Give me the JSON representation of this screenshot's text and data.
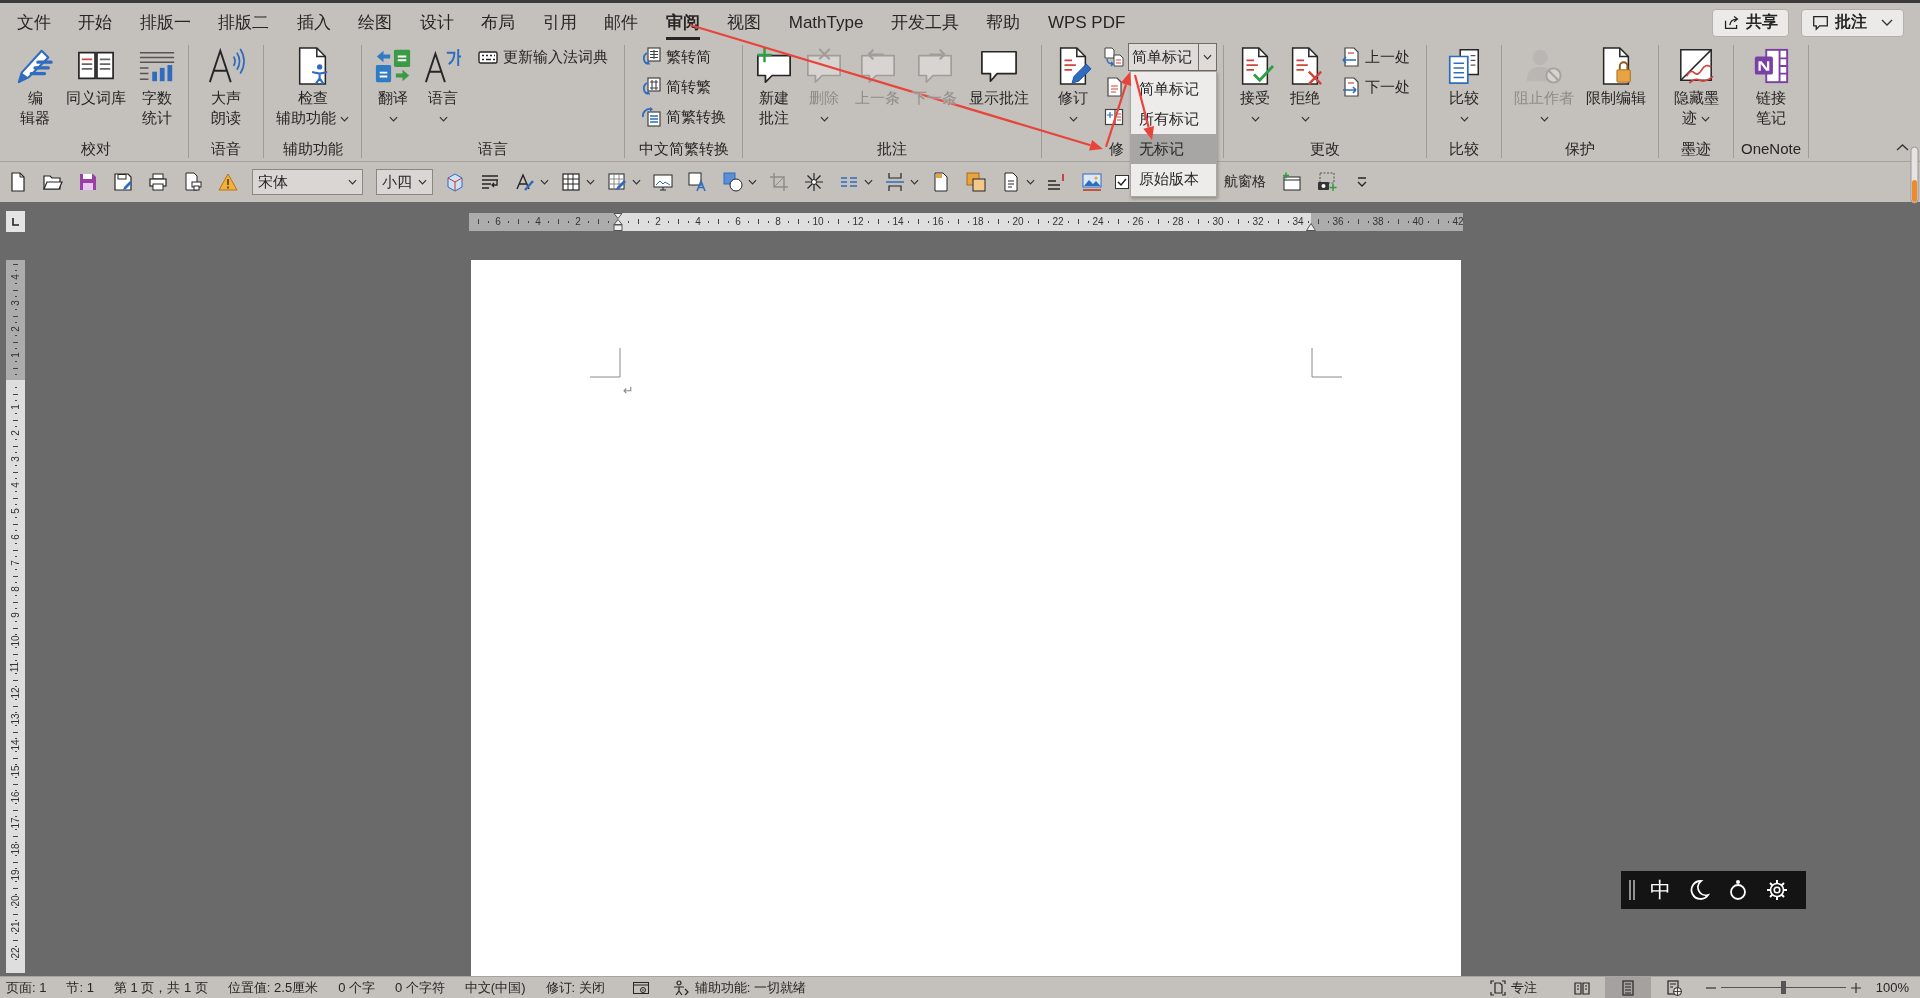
{
  "tabs": [
    {
      "label": "文件",
      "selected": false
    },
    {
      "label": "开始",
      "selected": false
    },
    {
      "label": "排版一",
      "selected": false
    },
    {
      "label": "排版二",
      "selected": false
    },
    {
      "label": "插入",
      "selected": false
    },
    {
      "label": "绘图",
      "selected": false
    },
    {
      "label": "设计",
      "selected": false
    },
    {
      "label": "布局",
      "selected": false
    },
    {
      "label": "引用",
      "selected": false
    },
    {
      "label": "邮件",
      "selected": false
    },
    {
      "label": "审阅",
      "selected": true
    },
    {
      "label": "视图",
      "selected": false
    },
    {
      "label": "MathType",
      "selected": false
    },
    {
      "label": "开发工具",
      "selected": false
    },
    {
      "label": "帮助",
      "selected": false
    },
    {
      "label": "WPS PDF",
      "selected": false
    }
  ],
  "header_buttons": [
    {
      "label": "共享",
      "dropdown": false
    },
    {
      "label": "批注",
      "dropdown": true
    }
  ],
  "ribbon": {
    "groups": [
      {
        "label": "校对",
        "items": [
          {
            "kind": "large",
            "lines": [
              "编",
              "辑器"
            ],
            "disabled": false,
            "dropdown": false
          },
          {
            "kind": "large",
            "lines": [
              "同义词库"
            ],
            "disabled": false,
            "dropdown": false
          },
          {
            "kind": "large",
            "lines": [
              "字数",
              "统计"
            ],
            "disabled": false,
            "dropdown": false
          }
        ]
      },
      {
        "label": "语音",
        "items": [
          {
            "kind": "large",
            "lines": [
              "大声",
              "朗读"
            ],
            "disabled": false,
            "dropdown": false
          }
        ]
      },
      {
        "label": "辅助功能",
        "items": [
          {
            "kind": "large",
            "lines": [
              "检查",
              "辅助功能"
            ],
            "disabled": false,
            "dropdown": true
          }
        ]
      },
      {
        "label": "语言",
        "items": [
          {
            "kind": "large",
            "lines": [
              "翻译"
            ],
            "disabled": false,
            "dropdown": true
          },
          {
            "kind": "large",
            "lines": [
              "语言"
            ],
            "disabled": false,
            "dropdown": true
          },
          {
            "kind": "stack",
            "buttons": [
              {
                "label": "更新输入法词典"
              }
            ]
          }
        ]
      },
      {
        "label": "中文简繁转换",
        "items": [
          {
            "kind": "stack",
            "buttons": [
              {
                "label": "繁转简"
              },
              {
                "label": "简转繁"
              },
              {
                "label": "简繁转换"
              }
            ]
          }
        ]
      },
      {
        "label": "批注",
        "items": [
          {
            "kind": "large",
            "lines": [
              "新建",
              "批注"
            ],
            "disabled": false,
            "dropdown": false
          },
          {
            "kind": "large",
            "lines": [
              "删除"
            ],
            "disabled": true,
            "dropdown": true
          },
          {
            "kind": "large",
            "lines": [
              "上一条"
            ],
            "disabled": true,
            "dropdown": false
          },
          {
            "kind": "large",
            "lines": [
              "下一条"
            ],
            "disabled": true,
            "dropdown": false
          },
          {
            "kind": "large",
            "lines": [
              "显示批注"
            ],
            "disabled": false,
            "dropdown": false
          }
        ]
      },
      {
        "label": "修",
        "launcher": true,
        "items": [
          {
            "kind": "large",
            "lines": [
              "修订"
            ],
            "disabled": false,
            "dropdown": true
          },
          {
            "kind": "icon_stack"
          },
          {
            "kind": "combo",
            "value": "简单标记",
            "menu": [
              {
                "label": "简单标记",
                "highlighted": false
              },
              {
                "label": "所有标记",
                "highlighted": false
              },
              {
                "label": "无标记",
                "highlighted": true
              },
              {
                "label": "原始版本",
                "highlighted": false
              }
            ]
          }
        ]
      },
      {
        "label": "更改",
        "items": [
          {
            "kind": "large",
            "lines": [
              "接受"
            ],
            "disabled": false,
            "dropdown": true
          },
          {
            "kind": "large",
            "lines": [
              "拒绝"
            ],
            "disabled": false,
            "dropdown": true
          },
          {
            "kind": "stack",
            "buttons": [
              {
                "label": "上一处"
              },
              {
                "label": "下一处"
              }
            ]
          }
        ]
      },
      {
        "label": "比较",
        "items": [
          {
            "kind": "large",
            "lines": [
              "比较"
            ],
            "disabled": false,
            "dropdown": true
          }
        ]
      },
      {
        "label": "保护",
        "items": [
          {
            "kind": "large",
            "lines": [
              "阻止作者"
            ],
            "disabled": true,
            "dropdown": true
          },
          {
            "kind": "large",
            "lines": [
              "限制编辑"
            ],
            "disabled": false,
            "dropdown": false
          }
        ]
      },
      {
        "label": "墨迹",
        "items": [
          {
            "kind": "large",
            "lines": [
              "隐藏墨",
              "迹"
            ],
            "disabled": false,
            "dropdown": true
          }
        ]
      },
      {
        "label": "OneNote",
        "items": [
          {
            "kind": "large",
            "lines": [
              "链接",
              "笔记"
            ],
            "disabled": false,
            "dropdown": false
          }
        ]
      }
    ]
  },
  "quick_access": {
    "font": "宋体",
    "font_size": "小四",
    "nav_checkbox": {
      "checked": true,
      "label": "航窗格"
    }
  },
  "horizontal_ruler": {
    "left_labels": [
      "6",
      "4",
      "2"
    ],
    "right_labels": [
      "2",
      "4",
      "6",
      "8",
      "10",
      "12",
      "14",
      "16",
      "18",
      "20",
      "22",
      "24",
      "26",
      "28",
      "30",
      "32",
      "34",
      "36",
      "38",
      "40",
      "42"
    ]
  },
  "vertical_ruler": {
    "top_labels": [
      "4",
      "3",
      "2",
      "1"
    ],
    "bottom_labels": [
      "1",
      "2",
      "3",
      "4",
      "5",
      "6",
      "7",
      "8",
      "9",
      "10",
      "11",
      "12",
      "13",
      "14",
      "15",
      "16",
      "17",
      "18",
      "19",
      "20",
      "21",
      "22"
    ]
  },
  "document": {
    "paragraph_mark": "↵"
  },
  "status_bar": {
    "texts": [
      "页面: 1",
      "节: 1",
      "第 1 页，共 1 页",
      "位置值: 2.5厘米",
      "0 个字",
      "0 个字符",
      "中文(中国)",
      "修订: 关闭"
    ],
    "accessibility": "辅助功能: 一切就绪",
    "focus": "专注",
    "views": [
      {
        "selected": false
      },
      {
        "selected": true
      },
      {
        "selected": false
      }
    ],
    "zoom": {
      "level": 0.5,
      "label": "100%"
    }
  },
  "ime_toolbar": {
    "mode": "中"
  }
}
